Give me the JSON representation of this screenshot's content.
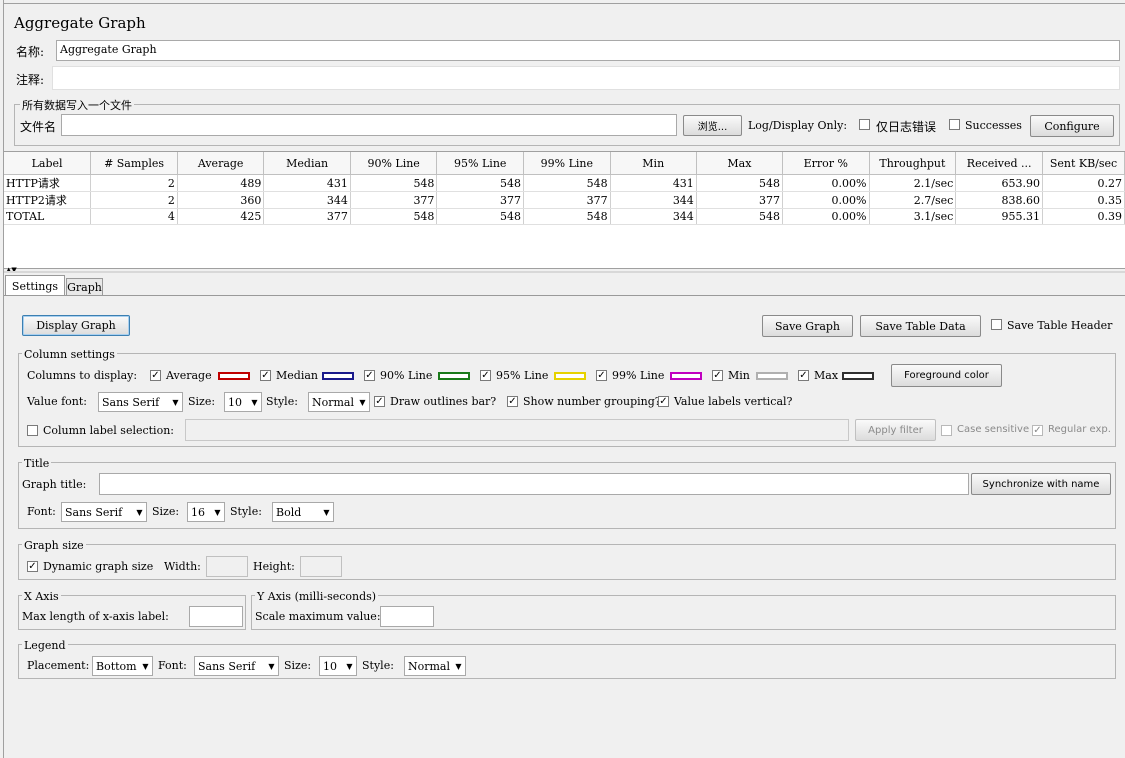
{
  "window": {
    "title": "Aggregate Graph"
  },
  "name_field": {
    "label": "名称:",
    "value": "Aggregate Graph"
  },
  "comment_field": {
    "label": "注释:",
    "value": ""
  },
  "file_group": {
    "legend": "所有数据写入一个文件",
    "filename_label": "文件名",
    "filename_value": "",
    "browse_label": "浏览...",
    "log_display_label": "Log/Display Only:",
    "errors_label": "仅日志错误",
    "successes_label": "Successes",
    "configure_label": "Configure"
  },
  "table": {
    "headers": [
      "Label",
      "# Samples",
      "Average",
      "Median",
      "90% Line",
      "95% Line",
      "99% Line",
      "Min",
      "Max",
      "Error %",
      "Throughput",
      "Received ...",
      "Sent KB/sec"
    ],
    "rows": [
      [
        "HTTP请求",
        "2",
        "489",
        "431",
        "548",
        "548",
        "548",
        "431",
        "548",
        "0.00%",
        "2.1/sec",
        "653.90",
        "0.27"
      ],
      [
        "HTTP2请求",
        "2",
        "360",
        "344",
        "377",
        "377",
        "377",
        "344",
        "377",
        "0.00%",
        "2.7/sec",
        "838.60",
        "0.35"
      ],
      [
        "TOTAL",
        "4",
        "425",
        "377",
        "548",
        "548",
        "548",
        "344",
        "548",
        "0.00%",
        "3.1/sec",
        "955.31",
        "0.39"
      ]
    ]
  },
  "tabs": [
    {
      "label": "Settings"
    },
    {
      "label": "Graph"
    }
  ],
  "toolbar": {
    "display_graph": "Display Graph",
    "save_graph": "Save Graph",
    "save_table_data": "Save Table Data",
    "save_table_header": "Save Table Header"
  },
  "column_settings": {
    "legend": "Column settings",
    "columns_label": "Columns to display:",
    "columns": [
      {
        "label": "Average",
        "checked": true,
        "color": "#c00000"
      },
      {
        "label": "Median",
        "checked": true,
        "color": "#1a1a8c"
      },
      {
        "label": "90% Line",
        "checked": true,
        "color": "#1a7a1a"
      },
      {
        "label": "95% Line",
        "checked": true,
        "color": "#e6d200"
      },
      {
        "label": "99% Line",
        "checked": true,
        "color": "#c000c0"
      },
      {
        "label": "Min",
        "checked": true,
        "color": "#b0b0b0"
      },
      {
        "label": "Max",
        "checked": true,
        "color": "#303030"
      }
    ],
    "foreground_label": "Foreground color",
    "value_font_label": "Value font:",
    "value_font": "Sans Serif",
    "size_label": "Size:",
    "size": "10",
    "style_label": "Style:",
    "style": "Normal",
    "draw_outlines_label": "Draw outlines bar?",
    "number_grouping_label": "Show number grouping?",
    "value_vertical_label": "Value labels vertical?",
    "column_label_selection": "Column label selection:",
    "apply_filter": "Apply filter",
    "case_sensitive": "Case sensitive",
    "regular_exp": "Regular exp."
  },
  "title_group": {
    "legend": "Title",
    "graph_title_label": "Graph title:",
    "graph_title_value": "",
    "sync_label": "Synchronize with name",
    "font_label": "Font:",
    "font": "Sans Serif",
    "size_label": "Size:",
    "size": "16",
    "style_label": "Style:",
    "style": "Bold"
  },
  "graph_size": {
    "legend": "Graph size",
    "dynamic_label": "Dynamic graph size",
    "width_label": "Width:",
    "height_label": "Height:",
    "width": "",
    "height": ""
  },
  "x_axis": {
    "legend": "X Axis",
    "max_length_label": "Max length of x-axis label:",
    "value": ""
  },
  "y_axis": {
    "legend": "Y Axis (milli-seconds)",
    "scale_label": "Scale maximum value:",
    "value": ""
  },
  "legend_group": {
    "legend": "Legend",
    "placement_label": "Placement:",
    "placement": "Bottom",
    "font_label": "Font:",
    "font": "Sans Serif",
    "size_label": "Size:",
    "size": "10",
    "style_label": "Style:",
    "style": "Normal"
  }
}
